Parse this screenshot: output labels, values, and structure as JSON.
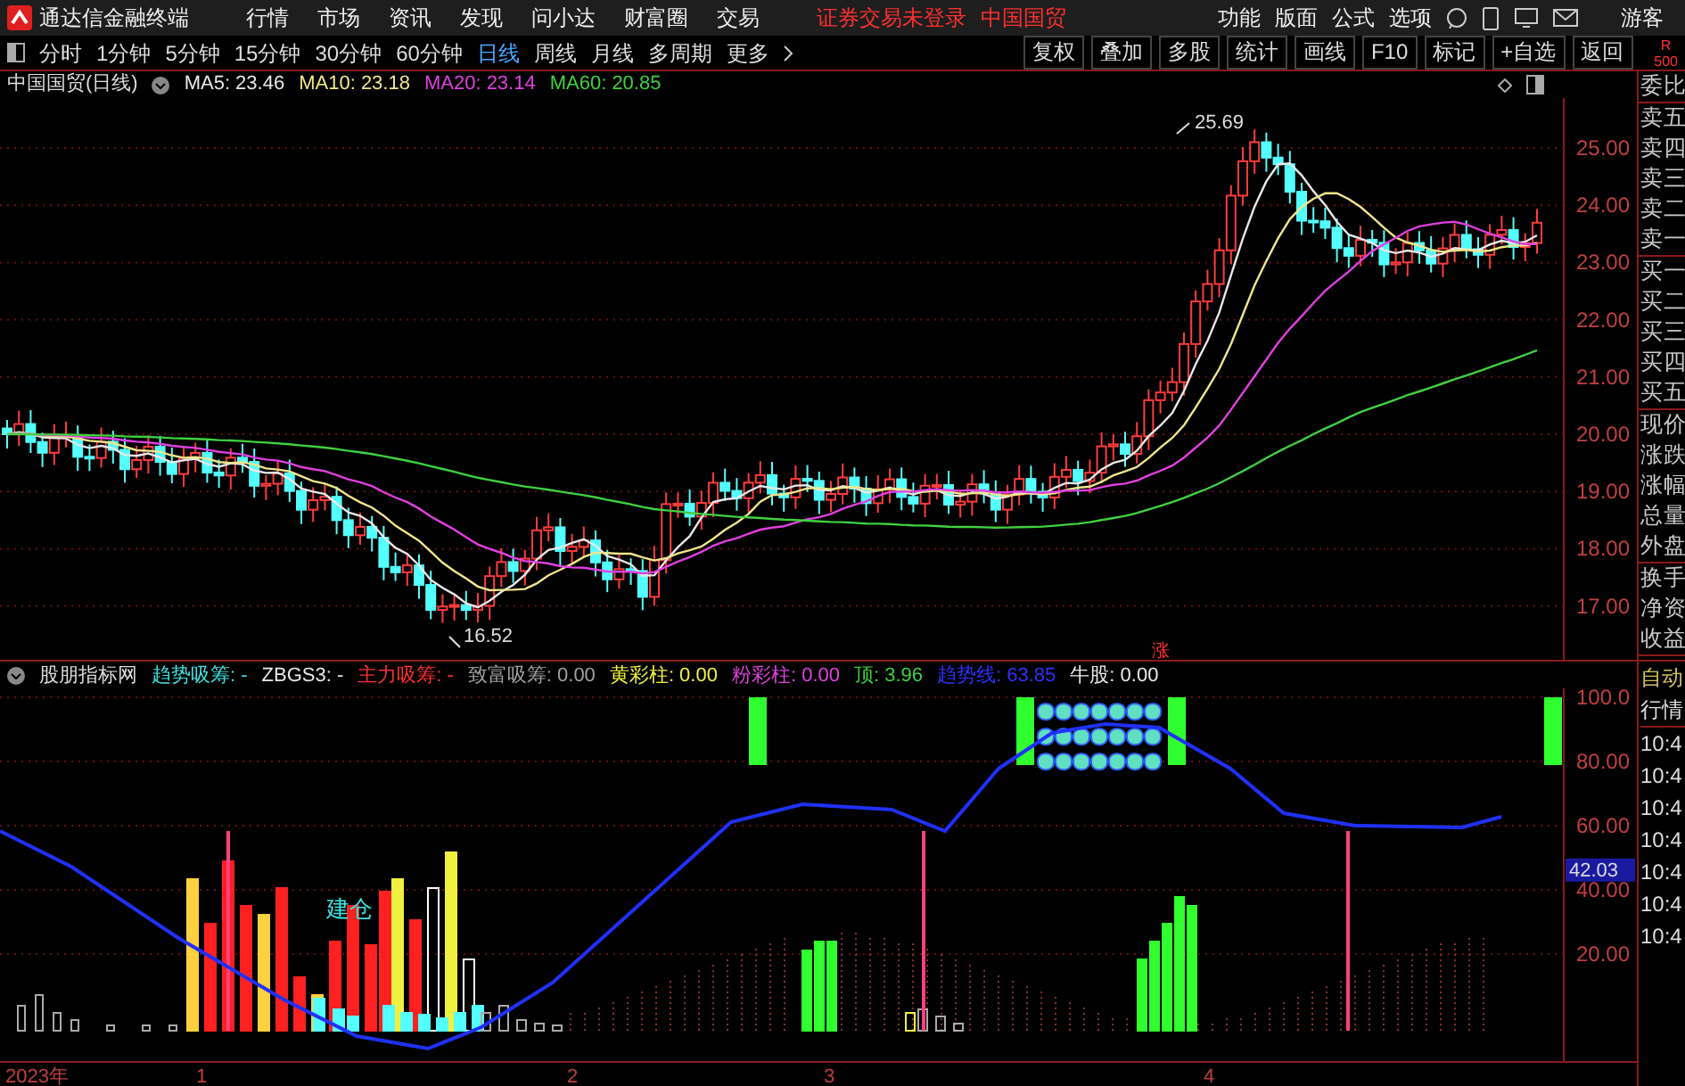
{
  "app": {
    "title": "通达信金融终端",
    "menus": [
      "行情",
      "市场",
      "资讯",
      "发现",
      "问小达",
      "财富圈",
      "交易"
    ],
    "notice": "证券交易未登录",
    "stock": "中国国贸",
    "tools": [
      "功能",
      "版面",
      "公式",
      "选项"
    ],
    "user": "游客"
  },
  "periods": [
    {
      "label": "分时",
      "selected": false
    },
    {
      "label": "1分钟",
      "selected": false
    },
    {
      "label": "5分钟",
      "selected": false
    },
    {
      "label": "15分钟",
      "selected": false
    },
    {
      "label": "30分钟",
      "selected": false
    },
    {
      "label": "60分钟",
      "selected": false
    },
    {
      "label": "日线",
      "selected": true
    },
    {
      "label": "周线",
      "selected": false
    },
    {
      "label": "月线",
      "selected": false
    },
    {
      "label": "多周期",
      "selected": false
    },
    {
      "label": "更多",
      "selected": false
    }
  ],
  "actions": [
    "复权",
    "叠加",
    "多股",
    "统计",
    "画线",
    "F10",
    "标记",
    "+自选",
    "返回"
  ],
  "corner": [
    "R",
    "500"
  ],
  "price_chart": {
    "title": "中国国贸(日线)",
    "ma": [
      {
        "label": "MA5: 23.46",
        "color": "#e8e8e8"
      },
      {
        "label": "MA10: 23.18",
        "color": "#f0e68c"
      },
      {
        "label": "MA20: 23.14",
        "color": "#e040e0"
      },
      {
        "label": "MA60: 20.85",
        "color": "#40d040"
      }
    ],
    "yticks": [
      "25.00",
      "24.00",
      "23.00",
      "22.00",
      "21.00",
      "20.00",
      "19.00",
      "18.00",
      "17.00"
    ],
    "high_label": "25.69",
    "low_label": "16.52",
    "marker": "涨"
  },
  "quote_groups": [
    [
      "委比"
    ],
    [
      "卖五",
      "卖四",
      "卖三",
      "卖二",
      "卖一"
    ],
    [
      "买一",
      "买二",
      "买三",
      "买四",
      "买五"
    ],
    [
      "现价",
      "涨跌",
      "涨幅",
      "总量",
      "外盘"
    ],
    [
      "换手",
      "净资",
      "收益"
    ]
  ],
  "indicator": {
    "name": "股朋指标网",
    "outputs": [
      {
        "label": "趋势吸筹: -",
        "color": "#40e0e0"
      },
      {
        "label": "ZBGS3: -",
        "color": "#e8e8e8"
      },
      {
        "label": "主力吸筹: -",
        "color": "#ff3030"
      },
      {
        "label": "致富吸筹: 0.00",
        "color": "#a0a0a0"
      },
      {
        "label": "黄彩柱: 0.00",
        "color": "#f0f040"
      },
      {
        "label": "粉彩柱: 0.00",
        "color": "#e040e0"
      },
      {
        "label": "顶: 3.96",
        "color": "#40d040"
      },
      {
        "label": "趋势线: 63.85",
        "color": "#3030ff"
      },
      {
        "label": "牛股: 0.00",
        "color": "#e8e8e8"
      }
    ],
    "yticks": [
      "100.0",
      "80.00",
      "60.00",
      "40.00",
      "20.00"
    ],
    "current": "42.03",
    "signal": "建仓"
  },
  "ticker": {
    "mode": [
      "自动",
      "行情"
    ],
    "times": [
      "10:4",
      "10:4",
      "10:4",
      "10:4",
      "10:4",
      "10:4",
      "10:4"
    ]
  },
  "date_axis": [
    "2023年",
    "1",
    "2",
    "3",
    "4"
  ]
}
